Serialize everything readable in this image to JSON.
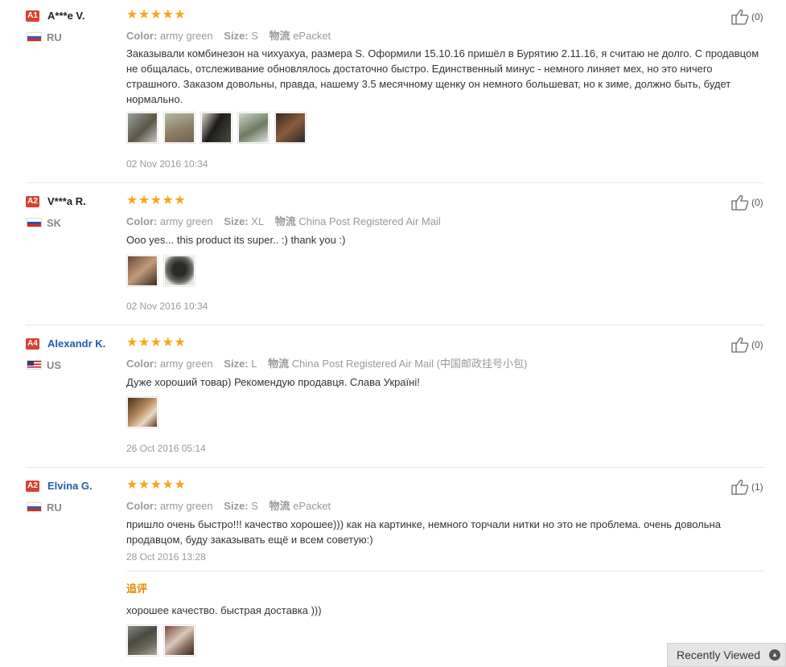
{
  "labels": {
    "color": "Color:",
    "size": "Size:",
    "logistics": "物流"
  },
  "stars": "★★★★★",
  "reviews": [
    {
      "level": "A1",
      "level_color": "#d9412f",
      "name": "A***e V.",
      "country": "RU",
      "color": "army green",
      "size": "S",
      "shipping": "ePacket",
      "text": "Заказывали комбинезон на чихуахуа, размера S. Оформили 15.10.16 пришёл в Бурятию 2.11.16, я считаю не долго. С продавцом не общалась, отслеживание обновлялось достаточно быстро. Единственный минус - немного линяет мех, но это ничего страшного. Заказом довольны, правда, нашему 3.5 месячному щенку он немного большеват, но к зиме, должно быть, будет нормально.",
      "date": "02 Nov 2016 10:34",
      "likes": "(0)"
    },
    {
      "level": "A2",
      "level_color": "#d9412f",
      "name": "V***a R.",
      "country": "SK",
      "color": "army green",
      "size": "XL",
      "shipping": "China Post Registered Air Mail",
      "text": "Ooo yes... this product its super.. :) thank you :)",
      "date": "02 Nov 2016 10:34",
      "likes": "(0)"
    },
    {
      "level": "A4",
      "level_color": "#d9412f",
      "name": "Alexandr K.",
      "country": "US",
      "color": "army green",
      "size": "L",
      "shipping": "China Post Registered Air Mail (中国邮政挂号小包)",
      "text": "Дуже хороший товар) Рекомендую продавця. Слава Україні!",
      "date": "26 Oct 2016 05:14",
      "likes": "(0)"
    },
    {
      "level": "A2",
      "level_color": "#d9412f",
      "name": "Elvina G.",
      "country": "RU",
      "color": "army green",
      "size": "S",
      "shipping": "ePacket",
      "text": "пришло очень быстро!!! качество хорошее))) как на картинке, немного торчали нитки но это не проблема. очень довольна продавцом, буду заказывать ещё и всем советую:)",
      "date": "28 Oct 2016 13:28",
      "likes": "(1)",
      "additional_title": "追评",
      "additional_text": "хорошее качество. быстрая доставка )))"
    }
  ],
  "recently_viewed": "Recently Viewed"
}
